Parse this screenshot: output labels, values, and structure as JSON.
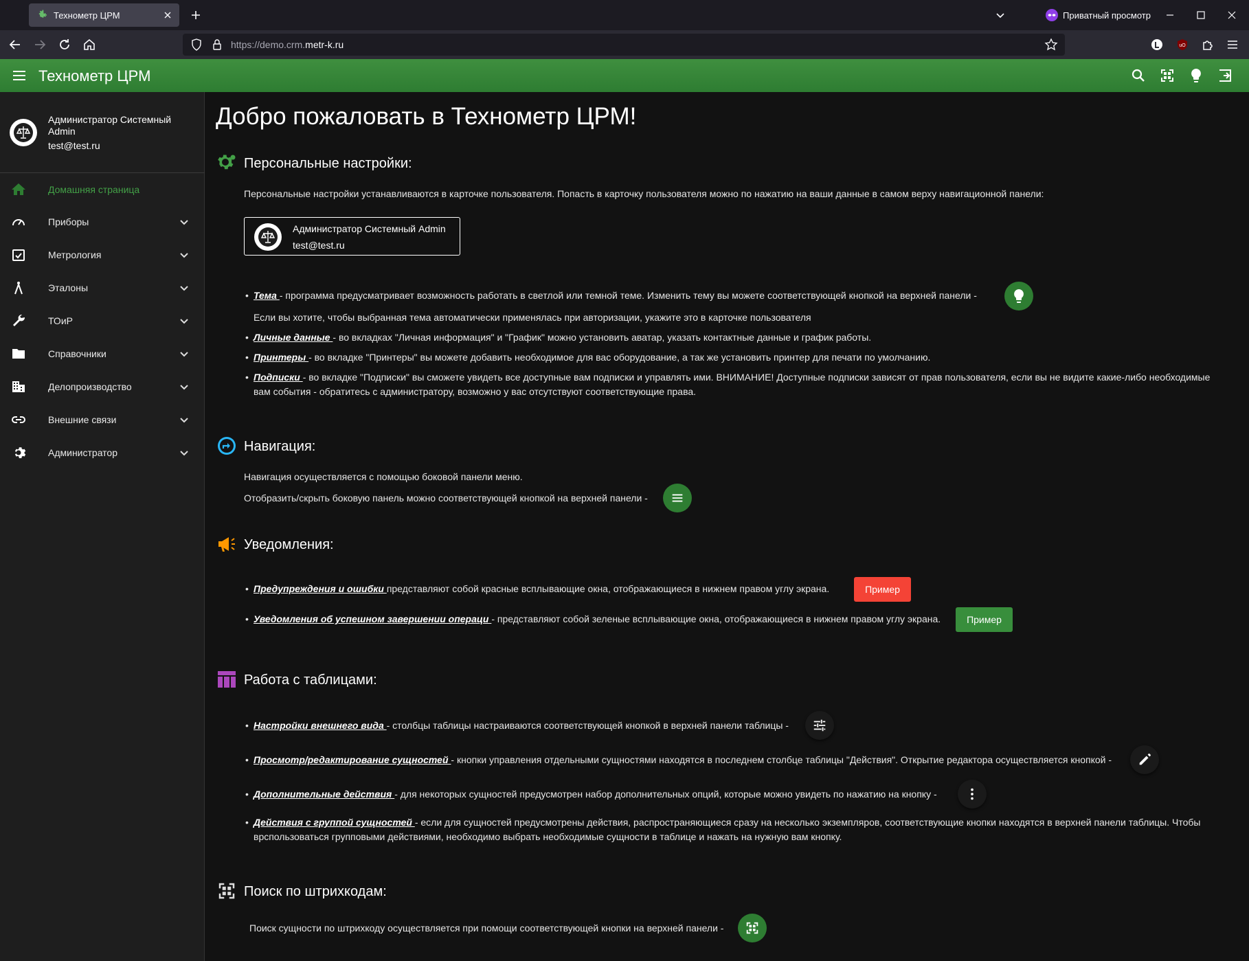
{
  "browser": {
    "tab_title": "Технометр ЦРМ",
    "private_label": "Приватный просмотр",
    "url_prefix": "https://demo.crm.",
    "url_host": "metr-k.ru"
  },
  "app": {
    "title": "Технометр ЦРМ"
  },
  "user": {
    "name": "Администратор Системный Admin",
    "email": "test@test.ru"
  },
  "sidebar": {
    "items": [
      {
        "label": "Домашняя страница",
        "icon": "home-icon",
        "active": true
      },
      {
        "label": "Приборы",
        "icon": "speedometer-icon"
      },
      {
        "label": "Метрология",
        "icon": "calendar-check-icon"
      },
      {
        "label": "Эталоны",
        "icon": "compass-icon"
      },
      {
        "label": "ТОиР",
        "icon": "wrench-icon"
      },
      {
        "label": "Справочники",
        "icon": "folder-icon"
      },
      {
        "label": "Делопроизводство",
        "icon": "office-building-icon"
      },
      {
        "label": "Внешние связи",
        "icon": "link-icon"
      },
      {
        "label": "Администратор",
        "icon": "gear-icon"
      }
    ]
  },
  "main": {
    "title": "Добро пожаловать в Технометр ЦРМ!",
    "personal": {
      "title": "Персональные настройки:",
      "intro": "Персональные настройки устанавливаются в карточке пользователя. Попасть в карточку пользователя можно по нажатию на ваши данные в самом верху навигационной панели:",
      "items": [
        {
          "key": "Тема ",
          "text": " - программа предусматривает возможность работать в светлой или темной теме. Изменить тему вы можете соответствующей кнопкой на верхней панели - "
        },
        {
          "key": "",
          "text": "Если вы хотите, чтобы выбранная тема автоматически применялась при авторизации, укажите это в карточке пользователя"
        },
        {
          "key": "Личные данные ",
          "text": " - во вкладках \"Личная информация\" и \"График\" можно установить аватар, указать контактные данные и график работы."
        },
        {
          "key": "Принтеры ",
          "text": " - во вкладке \"Принтеры\" вы можете добавить необходимое для вас оборудование, а так же установить принтер для печати по умолчанию."
        },
        {
          "key": "Подписки ",
          "text": " - во вкладке \"Подписки\" вы сможете увидеть все доступные вам подписки и управлять ими. ВНИМАНИЕ! Доступные подписки зависят от прав пользователя, если вы не видите какие-либо необходимые вам события - обратитесь с администратору, возможно у вас отсутствуют соответствующие права."
        }
      ]
    },
    "navigation": {
      "title": "Навигация:",
      "line1": "Навигация осуществляется с помощью боковой панели меню.",
      "line2": "Отобразить/скрыть боковую панель можно соответствующей кнопкой на верхней панели - "
    },
    "notifications": {
      "title": "Уведомления:",
      "items": [
        {
          "key": "Предупреждения и ошибки ",
          "text": "  представляют собой красные всплывающие окна, отображающиеся в нижнем правом углу экрана. ",
          "button": "Пример"
        },
        {
          "key": "Уведомления об успешном завершении операци ",
          "text": " - представляют собой зеленые всплывающие окна, отображающиеся в нижнем правом углу экрана. ",
          "button": "Пример"
        }
      ]
    },
    "tables": {
      "title": "Работа с таблицами:",
      "items": [
        {
          "key": "Настройки внешнего вида ",
          "text": " - столбцы таблицы настраиваются соответствующей кнопкой в верхней панели таблицы - "
        },
        {
          "key": "Просмотр/редактирование сущностей ",
          "text": " - кнопки управления отдельными сущностями находятся в последнем столбце таблицы \"Действия\". Открытие редактора осуществляется кнопкой - "
        },
        {
          "key": "Дополнительные действия ",
          "text": " - для некоторых сущностей предусмотрен набор дополнительных опций, которые можно увидеть по нажатию на кнопку - "
        },
        {
          "key": "Действия с группой сущностей ",
          "text": " - если для сущностей предусмотрены действия, распространяющиеся сразу на несколько экземпляров, соответствующие кнопки находятся в верхней панели таблицы. Чтобы врспользоваться групповыми действиями, необходимо выбрать необходимые сущности в таблице и нажать на нужную вам кнопку."
        }
      ]
    },
    "barcode": {
      "title": "Поиск по штрихкодам:",
      "text": "Поиск сущности по штрихкоду осуществляется при помощи соответствующей кнопки на верхней панели - "
    }
  },
  "colors": {
    "accent": "#2e7d32",
    "error": "#f44336",
    "success": "#388e3c"
  }
}
